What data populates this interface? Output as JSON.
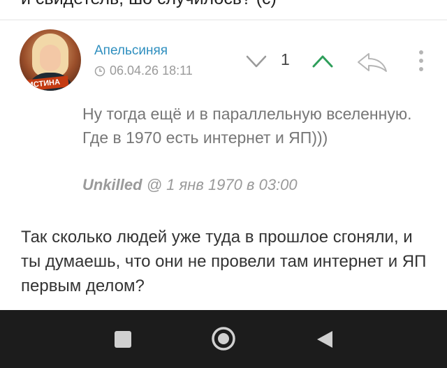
{
  "previous_snippet": "и свидетель, шо случилось? (с)",
  "comment": {
    "author": "Апельсиняя",
    "avatar_badge": "ИСТИНА",
    "timestamp": "06.04.26 18:11",
    "score": "1",
    "quote": {
      "text": "Ну тогда ещё и в параллельную вселенную. Где в 1970 есть интернет и ЯП)))",
      "author": "Unkilled",
      "date": "@ 1 янв 1970 в 03:00"
    },
    "body": "Так сколько людей уже туда в прошлое сгоняли, и ты думаешь, что они не провели там интернет и ЯП первым делом?"
  },
  "colors": {
    "author_link": "#2f8fbf",
    "upvote_active": "#2e9e5a",
    "navbar": "#1c1c1c"
  },
  "icons": {
    "vote_down": "chevron-down-icon",
    "vote_up": "chevron-up-icon",
    "reply": "reply-arrow-icon",
    "more": "more-vertical-icon",
    "clock": "clock-icon",
    "nav_recents": "square-icon",
    "nav_home": "circle-icon",
    "nav_back": "triangle-back-icon"
  }
}
